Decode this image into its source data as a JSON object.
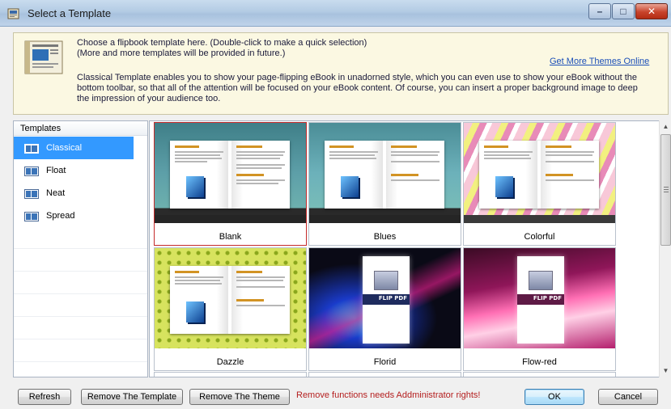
{
  "window": {
    "title": "Select a Template",
    "close_glyph": "✕",
    "min_glyph": "–",
    "max_glyph": "□"
  },
  "info": {
    "line1": "Choose a flipbook template here. (Double-click to make a quick selection)",
    "line2": "(More and more templates will be provided in future.)",
    "more_link": "Get More Themes Online",
    "description": "Classical Template enables you to show your page-flipping eBook in unadorned style, which you can even use to show your eBook without the bottom toolbar, so that all of the attention will be focused on your eBook content. Of course, you can insert a proper background image to deep the impression of your audience too."
  },
  "templates": {
    "header": "Templates",
    "items": [
      {
        "label": "Classical",
        "selected": true
      },
      {
        "label": "Float",
        "selected": false
      },
      {
        "label": "Neat",
        "selected": false
      },
      {
        "label": "Spread",
        "selected": false
      }
    ]
  },
  "themes": [
    {
      "label": "Blank",
      "selected": true
    },
    {
      "label": "Blues",
      "selected": false
    },
    {
      "label": "Colorful",
      "selected": false
    },
    {
      "label": "Dazzle",
      "selected": false
    },
    {
      "label": "Florid",
      "selected": false
    },
    {
      "label": "Flow-red",
      "selected": false
    }
  ],
  "cover_badge": "FLIP PDF",
  "scrollbar": {
    "up": "▲",
    "down": "▼"
  },
  "buttons": {
    "refresh": "Refresh",
    "remove_template": "Remove The Template",
    "remove_theme": "Remove The Theme",
    "ok": "OK",
    "cancel": "Cancel"
  },
  "warning": "Remove functions needs Addministrator rights!",
  "colors": {
    "selection": "#3399ff",
    "warning": "#b41e1e",
    "link": "#1b4fb8"
  }
}
